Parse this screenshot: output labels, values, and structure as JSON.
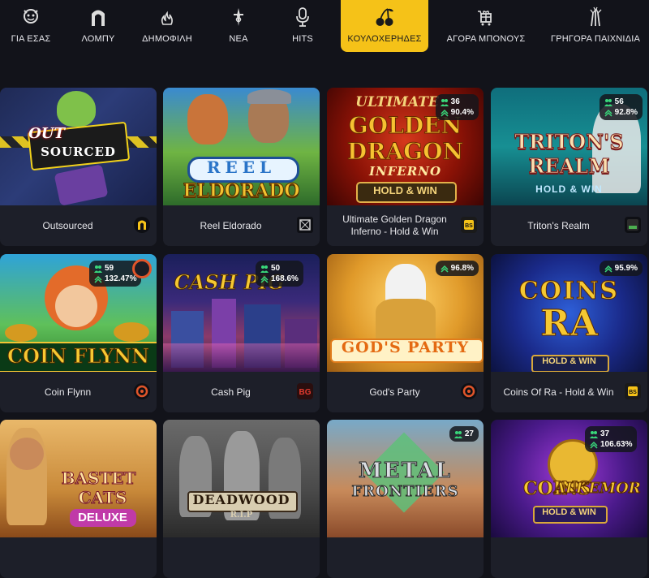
{
  "nav": {
    "items": [
      {
        "label": "ΓΙΑ ΕΣΑΣ",
        "icon": "mascot-icon"
      },
      {
        "label": "ΛΟΜΠΥ",
        "icon": "arch-icon"
      },
      {
        "label": "ΔΗΜΟΦΙΛΗ",
        "icon": "flame-icon"
      },
      {
        "label": "ΝΕΑ",
        "icon": "sparkle-icon"
      },
      {
        "label": "HITS",
        "icon": "microphone-icon"
      },
      {
        "label": "ΚΟΥΛΟΧΕΡΗΔΕΣ",
        "icon": "cherries-icon",
        "active": true
      },
      {
        "label": "ΑΓΟΡΑ ΜΠΟΝΟΥΣ",
        "icon": "gift-cart-icon"
      },
      {
        "label": "ΓΡΗΓΟΡΑ ΠΑΙΧΝΙΔΙΑ",
        "icon": "fireworks-icon"
      }
    ]
  },
  "games": [
    {
      "name": "Outsourced",
      "art_text": [
        "OUT",
        "SOURCED"
      ],
      "provider_icon": "provider-n-icon"
    },
    {
      "name": "Reel Eldorado",
      "art_text": [
        "REEL",
        "ELDORADO"
      ],
      "provider_icon": "provider-box-icon"
    },
    {
      "name": "Ultimate Golden Dragon Inferno - Hold & Win",
      "art_text": [
        "ULTIMATE",
        "GOLDEN",
        "DRAGON",
        "INFERNO",
        "HOLD & WIN"
      ],
      "players": "36",
      "rtp": "90.4%",
      "provider_icon": "provider-bs-icon"
    },
    {
      "name": "Triton's Realm",
      "art_text": [
        "TRITON'S",
        "REALM",
        "HOLD & WIN"
      ],
      "players": "56",
      "rtp": "92.8%",
      "provider_icon": "provider-game-icon"
    },
    {
      "name": "Coin Flynn",
      "art_text": [
        "COIN FLYNN"
      ],
      "players": "59",
      "rtp": "132.47%",
      "provider_icon": "provider-ring-icon"
    },
    {
      "name": "Cash Pig",
      "art_text": [
        "CASH PIG"
      ],
      "players": "50",
      "rtp": "168.6%",
      "provider_icon": "provider-bg-icon"
    },
    {
      "name": "God's Party",
      "art_text": [
        "GOD'S PARTY"
      ],
      "rtp": "96.8%",
      "provider_icon": "provider-ring-icon"
    },
    {
      "name": "Coins Of Ra - Hold & Win",
      "art_text": [
        "COINS",
        "RA",
        "HOLD & WIN"
      ],
      "rtp": "95.9%",
      "provider_icon": "provider-bs-icon"
    },
    {
      "name": "",
      "art_text": [
        "BASTET",
        "CATS",
        "DELUXE"
      ]
    },
    {
      "name": "",
      "art_text": [
        "DEADWOOD",
        "R.I.P"
      ]
    },
    {
      "name": "",
      "art_text": [
        "METAL",
        "FRONTIERS"
      ],
      "players": "27"
    },
    {
      "name": "",
      "art_text": [
        "COINS",
        "ALKEMOR",
        "HOLD & WIN"
      ],
      "players": "37",
      "rtp": "106.63%"
    }
  ],
  "colors": {
    "background": "#12131a",
    "card": "#1d1f29",
    "accent": "#f5c218",
    "stat_green": "#39d77a"
  }
}
